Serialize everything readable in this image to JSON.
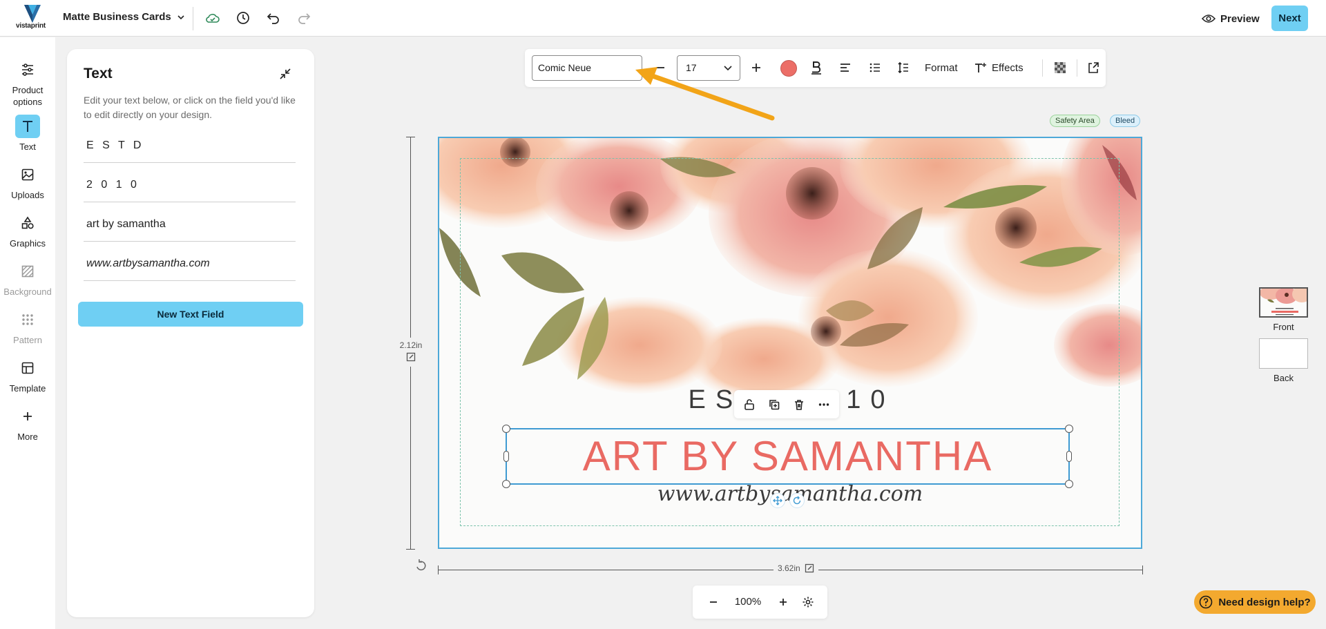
{
  "header": {
    "brand": "vistaprint",
    "product_name": "Matte Business Cards",
    "preview_label": "Preview",
    "next_label": "Next"
  },
  "rail": {
    "items": [
      {
        "label": "Product\noptions",
        "icon": "sliders-icon"
      },
      {
        "label": "Text",
        "icon": "text-icon"
      },
      {
        "label": "Uploads",
        "icon": "image-icon"
      },
      {
        "label": "Graphics",
        "icon": "shapes-icon"
      },
      {
        "label": "Background",
        "icon": "hatch-icon"
      },
      {
        "label": "Pattern",
        "icon": "dots-grid-icon"
      },
      {
        "label": "Template",
        "icon": "template-icon"
      },
      {
        "label": "More",
        "icon": "plus-icon"
      }
    ]
  },
  "panel": {
    "title": "Text",
    "description": "Edit your text below, or click on the field you'd like to edit directly on your design.",
    "fields": [
      "E S T D",
      "2 0 1 0",
      "art by samantha",
      "www.artbysamantha.com"
    ],
    "new_field_label": "New Text Field"
  },
  "toolbar": {
    "font": "Comic Neue",
    "size": "17",
    "color": "#ec6e67",
    "format_label": "Format",
    "effects_label": "Effects"
  },
  "canvas": {
    "safety_label": "Safety Area",
    "bleed_label": "Bleed",
    "height_label": "2.12in",
    "width_label": "3.62in",
    "estd_text": "ESTD 2010",
    "estd_visible_left": "ES",
    "estd_visible_right": "10",
    "headline": "ART BY SAMANTHA",
    "url": "www.artbysamantha.com"
  },
  "zoom": {
    "value": "100%"
  },
  "pages": {
    "front_label": "Front",
    "back_label": "Back"
  },
  "help": {
    "label": "Need design help?"
  },
  "colors": {
    "accent": "#6fcff3",
    "headline": "#e96a63",
    "selection": "#3e9ad2",
    "help": "#f3a92f",
    "arrow": "#f2a418"
  }
}
